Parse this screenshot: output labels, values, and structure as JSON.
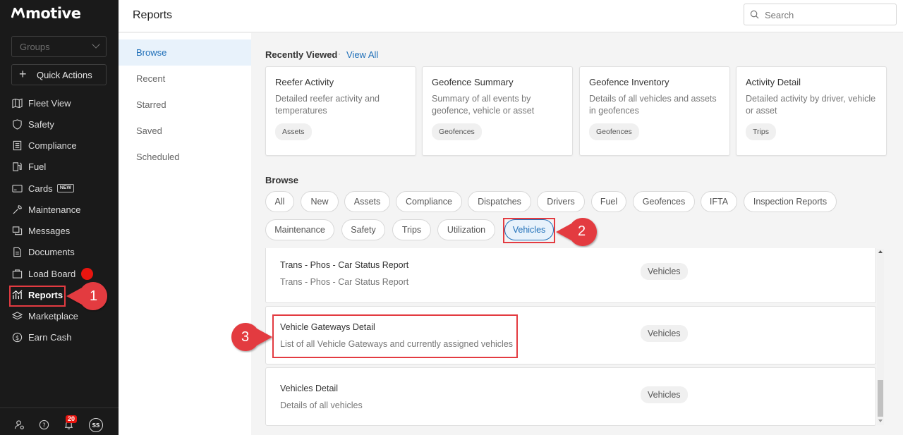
{
  "app": {
    "logo_text": "motive"
  },
  "sidebar": {
    "groups_placeholder": "Groups",
    "quick_actions_label": "Quick Actions",
    "items": [
      {
        "label": "Fleet View",
        "icon": "map-icon"
      },
      {
        "label": "Safety",
        "icon": "shield-icon"
      },
      {
        "label": "Compliance",
        "icon": "document-icon"
      },
      {
        "label": "Fuel",
        "icon": "fuel-pump-icon"
      },
      {
        "label": "Cards",
        "icon": "card-icon",
        "badge": "NEW"
      },
      {
        "label": "Maintenance",
        "icon": "wrench-icon"
      },
      {
        "label": "Messages",
        "icon": "messages-icon"
      },
      {
        "label": "Documents",
        "icon": "documents-icon"
      },
      {
        "label": "Load Board",
        "icon": "load-board-icon"
      },
      {
        "label": "Reports",
        "icon": "reports-chart-icon"
      },
      {
        "label": "Marketplace",
        "icon": "layers-icon"
      },
      {
        "label": "Earn Cash",
        "icon": "dollar-circle-icon"
      }
    ],
    "notification_count": "20",
    "avatar_initials": "SS"
  },
  "header": {
    "title": "Reports",
    "search_placeholder": "Search"
  },
  "subnav": {
    "items": [
      "Browse",
      "Recent",
      "Starred",
      "Saved",
      "Scheduled"
    ],
    "active": "Browse"
  },
  "recently_viewed": {
    "title": "Recently Viewed",
    "separator": "·",
    "view_all": "View All",
    "cards": [
      {
        "title": "Reefer Activity",
        "desc": "Detailed reefer activity and temperatures",
        "tag": "Assets"
      },
      {
        "title": "Geofence Summary",
        "desc": "Summary of all events by geofence, vehicle or asset",
        "tag": "Geofences"
      },
      {
        "title": "Geofence Inventory",
        "desc": "Details of all vehicles and assets in geofences",
        "tag": "Geofences"
      },
      {
        "title": "Activity Detail",
        "desc": "Detailed activity by driver, vehicle or asset",
        "tag": "Trips"
      }
    ]
  },
  "browse": {
    "title": "Browse",
    "filters": [
      "All",
      "New",
      "Assets",
      "Compliance",
      "Dispatches",
      "Drivers",
      "Fuel",
      "Geofences",
      "IFTA",
      "Inspection Reports",
      "Maintenance",
      "Safety",
      "Trips",
      "Utilization",
      "Vehicles"
    ],
    "active_filter": "Vehicles"
  },
  "reports": [
    {
      "title": "Trans - Phos - Car Status Report",
      "desc": "Trans - Phos - Car Status Report",
      "tag": "Vehicles"
    },
    {
      "title": "Vehicle Gateways Detail",
      "desc": "List of all Vehicle Gateways and currently assigned vehicles",
      "tag": "Vehicles"
    },
    {
      "title": "Vehicles Detail",
      "desc": "Details of all vehicles",
      "tag": "Vehicles"
    }
  ],
  "callouts": [
    "1",
    "2",
    "3"
  ],
  "colors": {
    "sidebar_bg": "#1a1a1a",
    "accent": "#1f6fb8",
    "callout_red": "#e33b41",
    "notification_red": "#e8150f"
  }
}
